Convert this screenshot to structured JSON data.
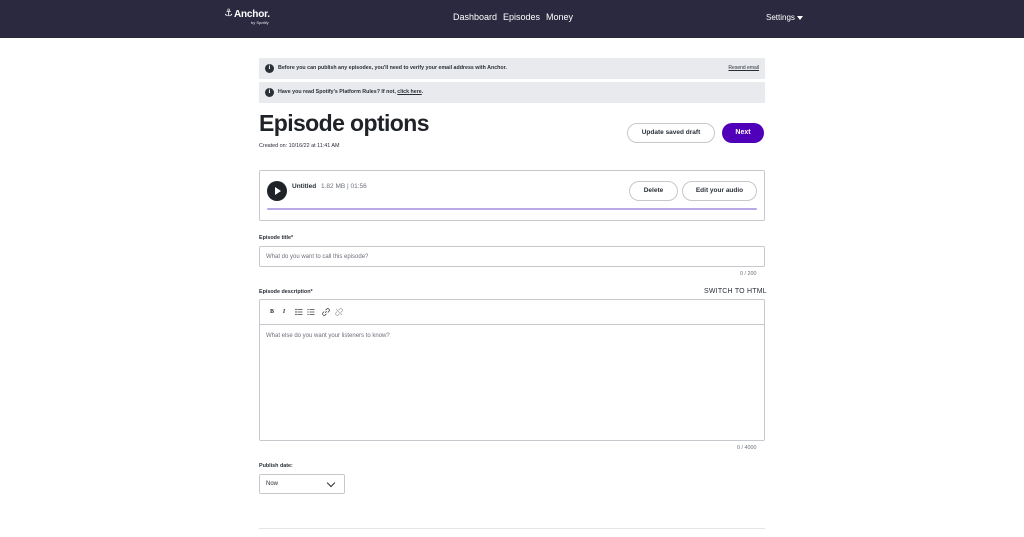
{
  "nav": {
    "logo_text": "Anchor.",
    "logo_sub": "by Spotify",
    "links": [
      "Dashboard",
      "Episodes",
      "Money"
    ],
    "settings_label": "Settings"
  },
  "banners": {
    "verify_text": "Before you can publish any episodes, you'll need to verify your email address with Anchor.",
    "resend_label": "Resend email",
    "rules_text_before": "Have you read Spotify's Platform Rules? If not, ",
    "rules_link": "click here",
    "rules_text_after": "."
  },
  "page": {
    "title": "Episode options",
    "created": "Created on: 10/16/22 at 11:41 AM",
    "update_draft_label": "Update saved draft",
    "next_label": "Next"
  },
  "audio": {
    "title": "Untitled",
    "meta": "1.82 MB | 01:56",
    "delete_label": "Delete",
    "edit_label": "Edit your audio"
  },
  "form": {
    "title_label": "Episode title*",
    "title_placeholder": "What do you want to call this episode?",
    "title_counter": "0  /  200",
    "description_label": "Episode description*",
    "switch_html_label": "SWITCH TO HTML",
    "description_placeholder": "What else do you want your listeners to know?",
    "description_counter": "0  /  4000",
    "publish_label": "Publish date:",
    "publish_value": "Now"
  },
  "colors": {
    "nav_bg": "#2b2940",
    "primary": "#5000b9",
    "banner_bg": "#e9eaed",
    "progress": "#b9a9e8"
  },
  "icons": [
    "info-icon",
    "play-icon",
    "bold-icon",
    "italic-icon",
    "bulleted-list-icon",
    "numbered-list-icon",
    "link-icon",
    "unlink-icon",
    "chevron-down-icon"
  ]
}
